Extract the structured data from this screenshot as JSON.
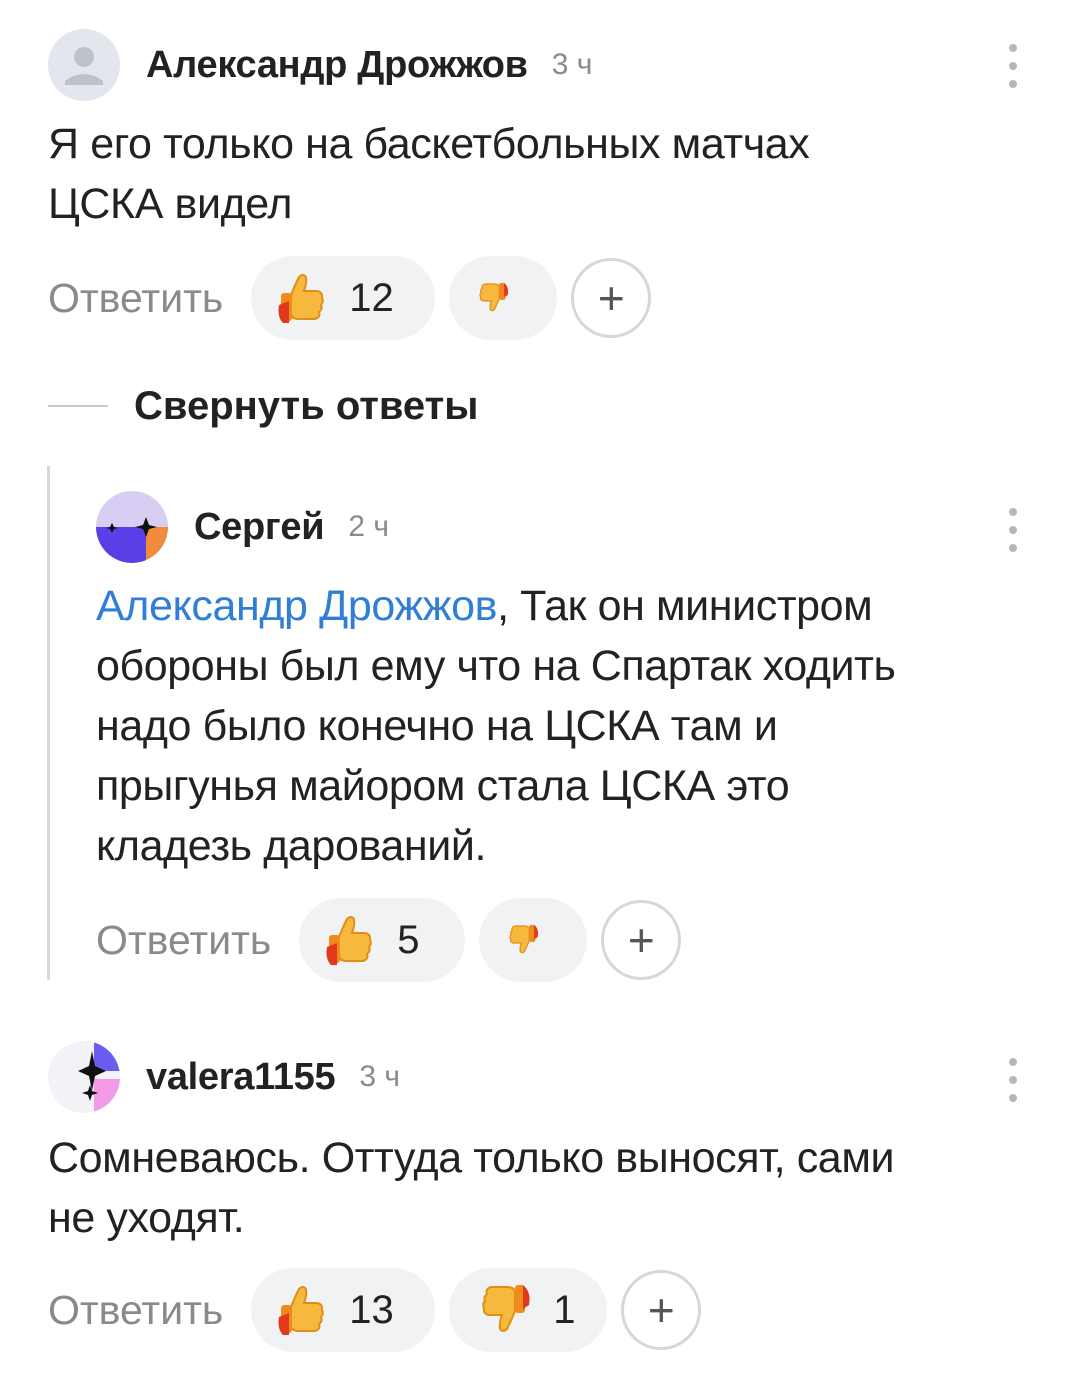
{
  "comments": [
    {
      "author": "Александр Дрожжов",
      "time": "3 ч",
      "text_lines": [
        "Я его только на баскетбольных матчах",
        "ЦСКА видел"
      ],
      "reply_label": "Ответить",
      "likes": "12",
      "dislikes": ""
    },
    {
      "author": "Сергей",
      "time": "2 ч",
      "mention": "Александр Дрожжов",
      "text_first": ", Так он министром",
      "text_lines": [
        "обороны был ему что на Спартак ходить",
        "надо было конечно на ЦСКА там и",
        "прыгунья майором стала ЦСКА это",
        "кладезь дарований."
      ],
      "reply_label": "Ответить",
      "likes": "5",
      "dislikes": ""
    },
    {
      "author": "valera1155",
      "time": "3 ч",
      "text_lines": [
        "Сомневаюсь. Оттуда только выносят, сами",
        "не уходят."
      ],
      "reply_label": "Ответить",
      "likes": "13",
      "dislikes": "1"
    }
  ],
  "collapse_label": "Свернуть ответы",
  "plus_label": "+",
  "colors": {
    "mention": "#2f7fd6",
    "muted": "#8a8a8a",
    "pill_bg": "#f1f2f4"
  },
  "icons": {
    "like": "thumbs-up-icon",
    "dislike": "thumbs-down-icon",
    "menu": "more-vertical-icon"
  }
}
